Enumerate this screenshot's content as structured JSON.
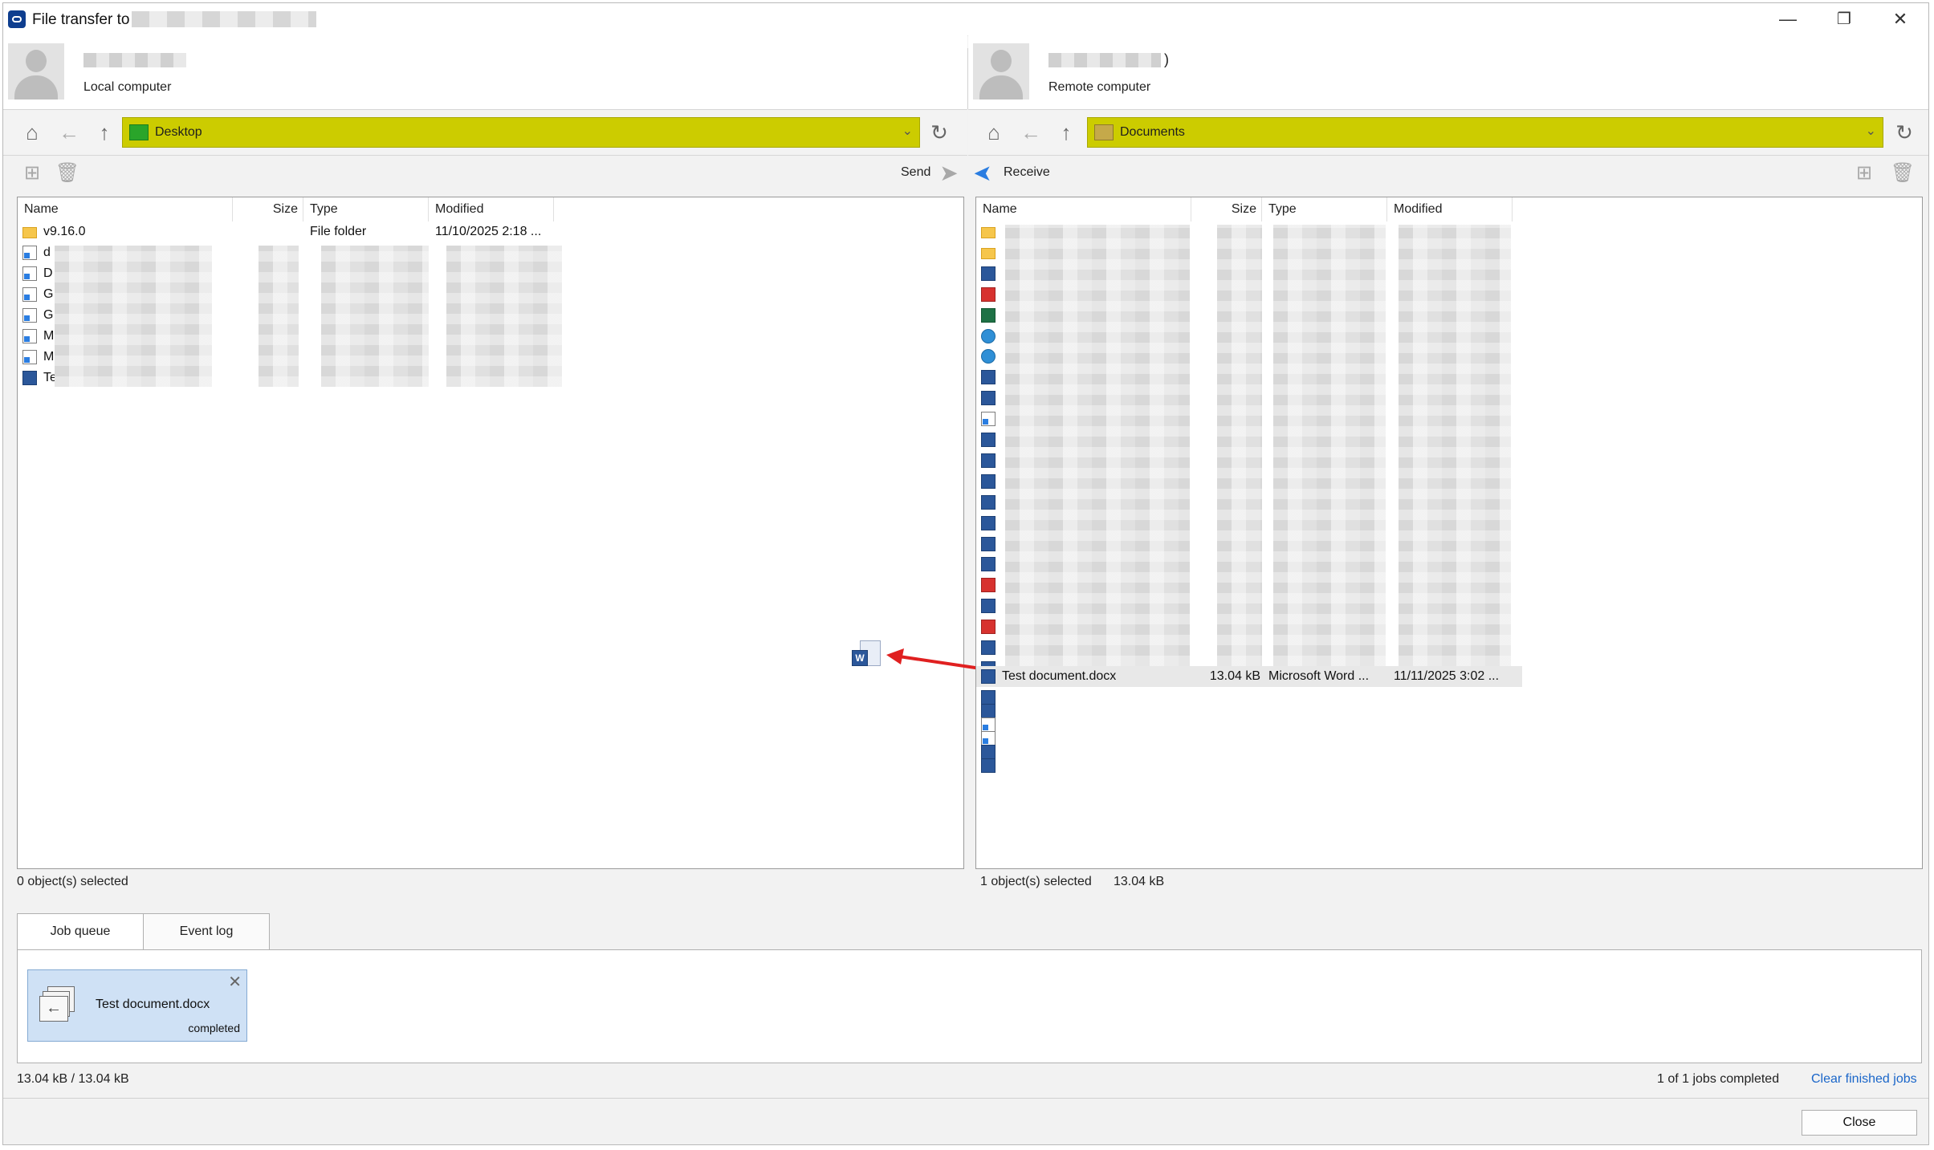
{
  "window": {
    "title": "File transfer to",
    "minimize": "—",
    "restore": "❐",
    "close": "✕"
  },
  "local": {
    "label": "Local computer",
    "path": "Desktop",
    "send_label": "Send",
    "status": "0 object(s) selected",
    "columns": [
      "Name",
      "Size",
      "Type",
      "Modified"
    ],
    "rows": [
      {
        "name": "v9.16.0",
        "size": "",
        "type": "File folder",
        "modified": "11/10/2025 2:18 ...",
        "icon": "folder-icon"
      },
      {
        "name": "d",
        "icon": "shortcut-icon"
      },
      {
        "name": "D",
        "icon": "shortcut-icon"
      },
      {
        "name": "G",
        "icon": "shortcut-icon"
      },
      {
        "name": "G",
        "icon": "shortcut-icon"
      },
      {
        "name": "M",
        "icon": "shortcut-icon"
      },
      {
        "name": "M",
        "icon": "shortcut-icon"
      },
      {
        "name": "Te",
        "icon": "word-icon"
      }
    ]
  },
  "remote": {
    "label": "Remote computer",
    "name_suffix": ")",
    "path": "Documents",
    "receive_label": "Receive",
    "status": "1 object(s) selected",
    "status_size": "13.04 kB",
    "columns": [
      "Name",
      "Size",
      "Type",
      "Modified"
    ],
    "selected_row": {
      "name": "Test document.docx",
      "size": "13.04 kB",
      "type": "Microsoft Word ...",
      "modified": "11/11/2025 3:02 ..."
    },
    "row_icons": [
      "folder-icon",
      "folder-icon",
      "word-icon",
      "pdf-icon",
      "excel-icon",
      "edge-icon",
      "edge-icon",
      "word-icon",
      "word-icon",
      "shortcut-icon",
      "word-icon",
      "word-icon",
      "word-icon",
      "word-icon",
      "word-icon",
      "word-icon",
      "word-icon",
      "pdf-icon",
      "word-icon",
      "pdf-icon",
      "word-icon",
      "word-icon"
    ],
    "after_icons": [
      "word-icon",
      "word-icon",
      "shortcut-icon",
      "shortcut-icon",
      "word-icon",
      "word-icon"
    ]
  },
  "tabs": {
    "job_queue": "Job queue",
    "event_log": "Event log"
  },
  "job": {
    "name": "Test document.docx",
    "status": "completed",
    "close": "✕"
  },
  "footer": {
    "transferred": "13.04 kB / 13.04 kB",
    "jobs_completed": "1 of 1 jobs completed",
    "clear_link": "Clear finished jobs",
    "close_button": "Close"
  },
  "colors": {
    "path_highlight": "#cccc00",
    "selection": "#cfe1f5",
    "arrow": "#e02020",
    "link": "#1a66c9"
  }
}
